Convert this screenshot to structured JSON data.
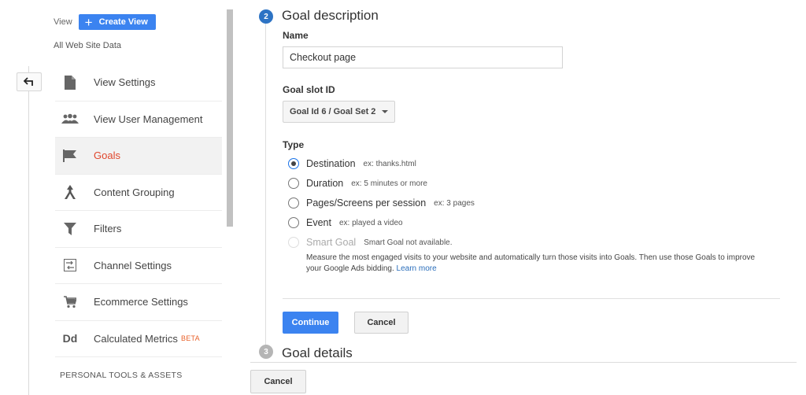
{
  "sidebar": {
    "view_label": "View",
    "create_view_label": "Create View",
    "view_name": "All Web Site Data",
    "items": [
      {
        "label": "View Settings",
        "icon": "document-icon"
      },
      {
        "label": "View User Management",
        "icon": "users-icon"
      },
      {
        "label": "Goals",
        "icon": "flag-icon",
        "active": true
      },
      {
        "label": "Content Grouping",
        "icon": "content-grouping-icon"
      },
      {
        "label": "Filters",
        "icon": "filter-icon"
      },
      {
        "label": "Channel Settings",
        "icon": "channel-settings-icon"
      },
      {
        "label": "Ecommerce Settings",
        "icon": "cart-icon"
      },
      {
        "label": "Calculated Metrics",
        "icon": "dd-icon",
        "badge": "BETA"
      }
    ],
    "section_title": "PERSONAL TOOLS & ASSETS"
  },
  "goal_description": {
    "step": "2",
    "heading": "Goal description",
    "name_label": "Name",
    "name_value": "Checkout page",
    "slot_label": "Goal slot ID",
    "slot_value": "Goal Id 6 / Goal Set 2",
    "type_label": "Type",
    "types": [
      {
        "label": "Destination",
        "example": "ex: thanks.html",
        "checked": true
      },
      {
        "label": "Duration",
        "example": "ex: 5 minutes or more"
      },
      {
        "label": "Pages/Screens per session",
        "example": "ex: 3 pages"
      },
      {
        "label": "Event",
        "example": "ex: played a video"
      },
      {
        "label": "Smart Goal",
        "example": "Smart Goal not available.",
        "disabled": true
      }
    ],
    "smart_goal_description": "Measure the most engaged visits to your website and automatically turn those visits into Goals. Then use those Goals to improve your Google Ads bidding.",
    "learn_more": "Learn more",
    "continue_label": "Continue",
    "cancel_label": "Cancel"
  },
  "goal_details": {
    "step": "3",
    "heading": "Goal details"
  },
  "footer": {
    "cancel_label": "Cancel"
  },
  "colors": {
    "accent": "#3b83f0",
    "active_nav": "#e0462c",
    "step_badge": "#2d73c4",
    "beta": "#e8622b"
  }
}
